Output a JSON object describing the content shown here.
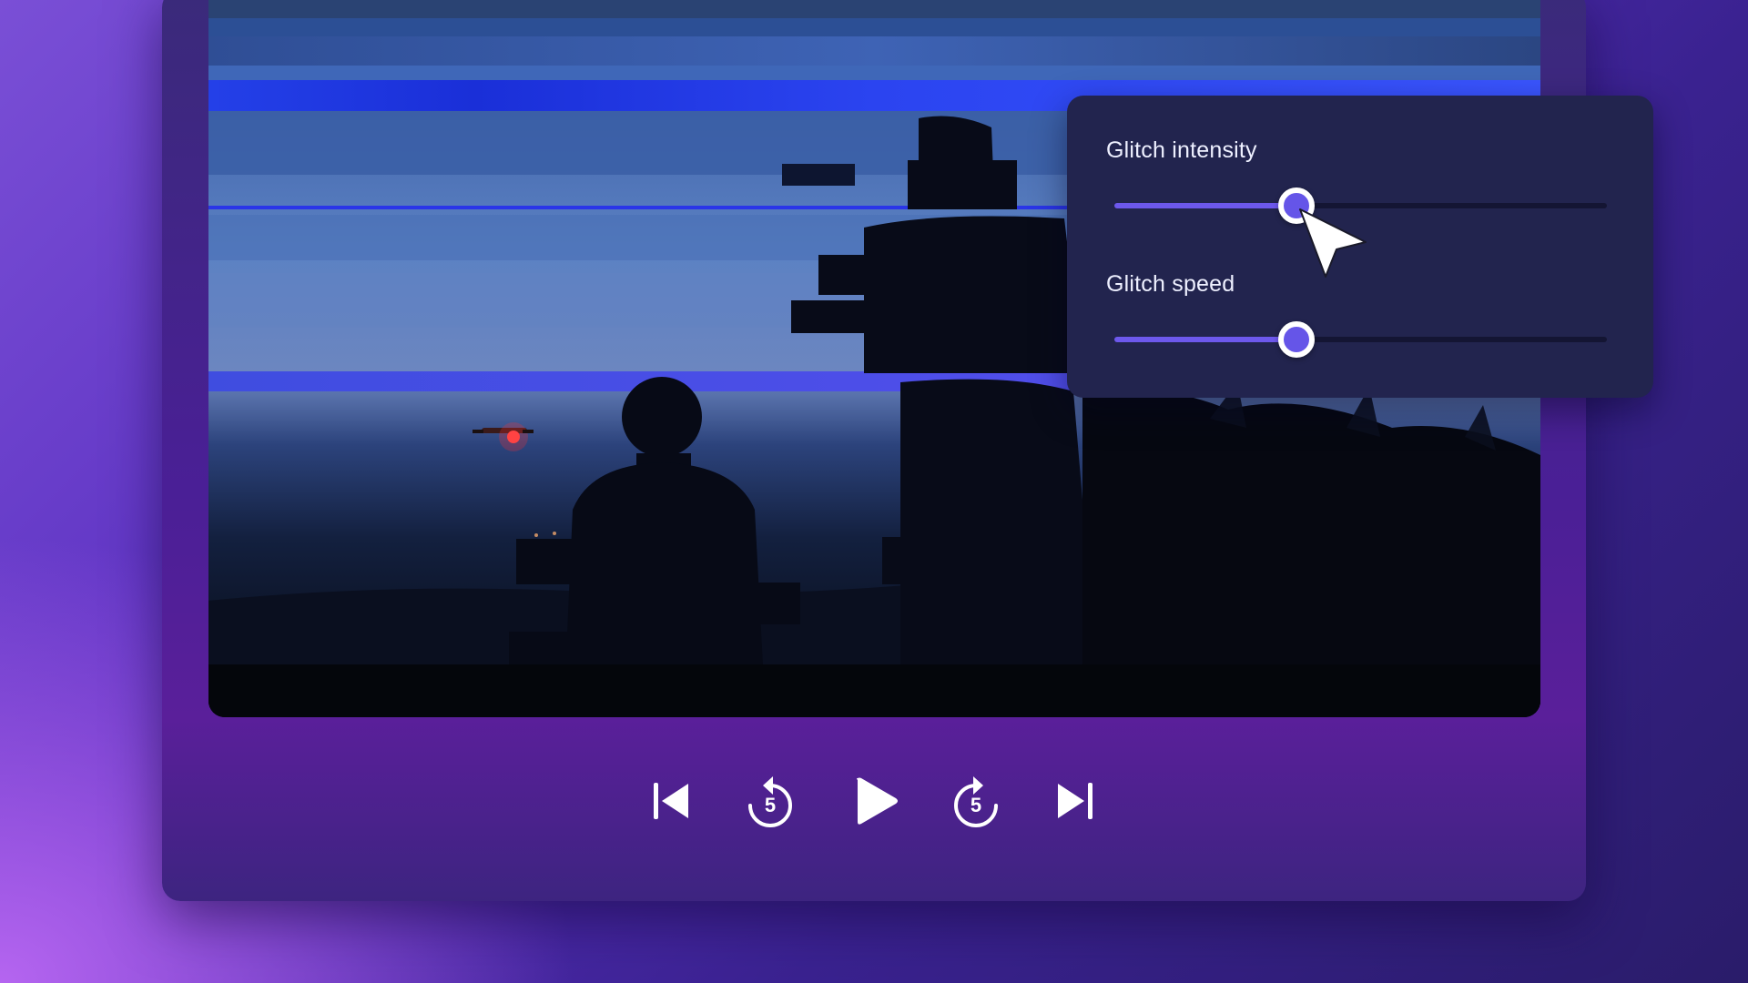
{
  "player": {
    "controls": [
      {
        "id": "skip-back",
        "icon": "skip-to-start-icon"
      },
      {
        "id": "rewind-5",
        "icon": "rewind-5-seconds-icon",
        "label": "5"
      },
      {
        "id": "play",
        "icon": "play-icon"
      },
      {
        "id": "forward-5",
        "icon": "forward-5-seconds-icon",
        "label": "5"
      },
      {
        "id": "skip-forward",
        "icon": "skip-to-end-icon"
      }
    ]
  },
  "effect_panel": {
    "sliders": [
      {
        "label": "Glitch intensity",
        "value": 0.37
      },
      {
        "label": "Glitch speed",
        "value": 0.37
      }
    ]
  },
  "colors": {
    "accent": "#6555e8",
    "panel_bg": "#22244e",
    "glitch_band": "#2a3df0"
  }
}
